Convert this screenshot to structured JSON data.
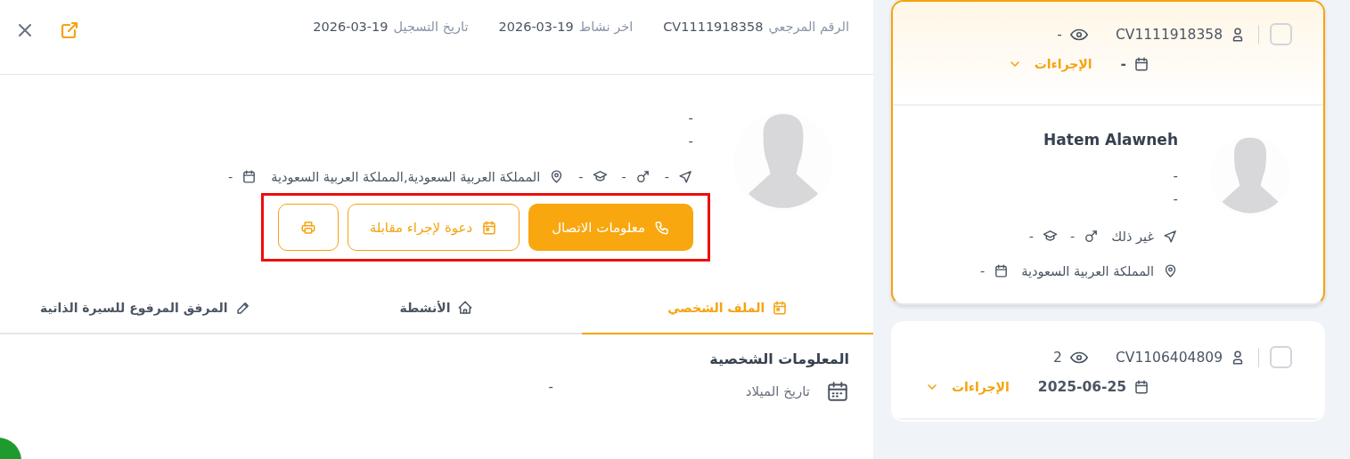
{
  "detail": {
    "header": {
      "fields": [
        {
          "label": "الرقم المرجعي",
          "value": "CV1111918358"
        },
        {
          "label": "اخر نشاط",
          "value": "2026-03-19"
        },
        {
          "label": "تاريخ التسجيل",
          "value": "2026-03-19"
        }
      ]
    },
    "profile": {
      "lines": [
        "-",
        "-"
      ],
      "facts": [
        {
          "kind": "send",
          "text": "-"
        },
        {
          "kind": "gender",
          "text": "-"
        },
        {
          "kind": "education",
          "text": "-"
        },
        {
          "kind": "location",
          "text": "المملكة العربية السعودية,المملكة العربية السعودية"
        },
        {
          "kind": "calendar",
          "text": "-"
        }
      ],
      "actions": [
        {
          "kind": "contact",
          "label": "معلومات الاتصال"
        },
        {
          "kind": "interview",
          "label": "دعوة لإجراء مقابلة"
        },
        {
          "kind": "print"
        }
      ],
      "actions_highlighted": true
    },
    "tabs": [
      {
        "kind": "profile",
        "label": "الملف الشخصي",
        "selected": true
      },
      {
        "kind": "activities",
        "label": "الأنشطة",
        "selected": false
      },
      {
        "kind": "attachment",
        "label": "المرفق المرفوع للسيرة الذاتية",
        "selected": false
      }
    ],
    "section": {
      "title": "المعلومات الشخصية",
      "rows": [
        {
          "label": "تاريخ الميلاد",
          "value": "-"
        }
      ]
    }
  },
  "cards": [
    {
      "selected": true,
      "checked": false,
      "ref": "CV1111918358",
      "views": "-",
      "date": "-",
      "actions_label": "الإجراءات",
      "name": "Hatem Alawneh",
      "lines": [
        "-",
        "-"
      ],
      "facts": [
        [
          {
            "kind": "send",
            "text": "غير ذلك"
          },
          {
            "kind": "gender",
            "text": "-"
          },
          {
            "kind": "education",
            "text": "-"
          }
        ],
        [
          {
            "kind": "location",
            "text": "المملكة العربية السعودية"
          },
          {
            "kind": "calendar",
            "text": "-"
          }
        ]
      ]
    },
    {
      "selected": false,
      "checked": false,
      "ref": "CV1106404809",
      "views": "2",
      "date": "2025-06-25",
      "actions_label": "الإجراءات"
    }
  ]
}
